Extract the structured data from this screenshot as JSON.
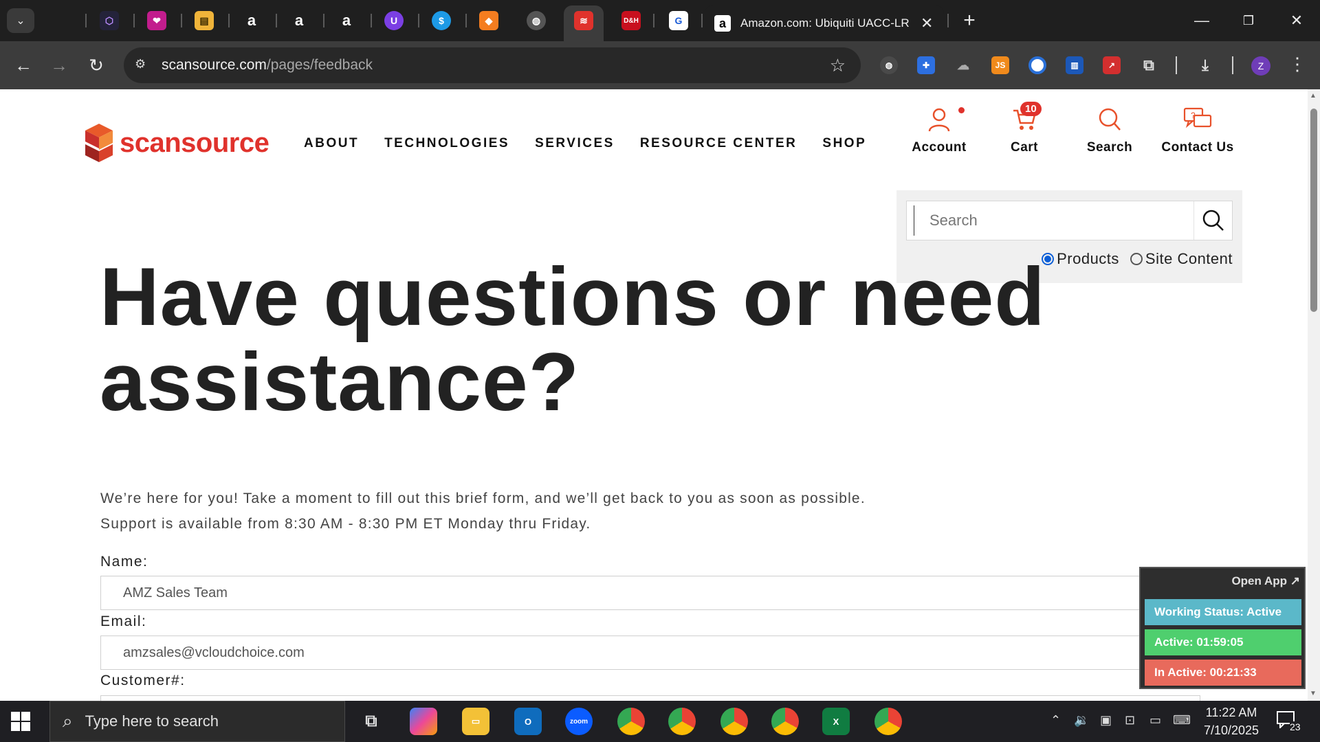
{
  "browser": {
    "active_tab_title": "Amazon.com: Ubiquiti UACC-LR",
    "tab_favicons": [
      "cube-icon",
      "heart-icon",
      "box-icon",
      "amazon-icon",
      "amazon-icon",
      "amazon-icon",
      "u-icon",
      "dollar-icon",
      "package-icon",
      "globe-icon",
      "scansource-icon",
      "dh-icon",
      "g-icon"
    ],
    "url_host": "scansource.com",
    "url_path": "/pages/feedback",
    "profile_initial": "Z",
    "ext_js_label": "JS"
  },
  "site": {
    "logo_text": "scansource",
    "nav": [
      "ABOUT",
      "TECHNOLOGIES",
      "SERVICES",
      "RESOURCE CENTER",
      "SHOP"
    ],
    "utility": {
      "account": "Account",
      "cart": "Cart",
      "cart_count": "10",
      "search": "Search",
      "contact": "Contact Us"
    },
    "search_panel": {
      "placeholder": "Search",
      "options": [
        "Products",
        "Site Content"
      ],
      "selected": "Products"
    },
    "heading": "Have questions or need assistance?",
    "intro_line1": "We’re here for you! Take a moment to fill out this brief form, and we’ll get back to you as soon as possible.",
    "intro_line2": "Support is available from 8:30 AM - 8:30 PM ET Monday thru Friday.",
    "form": {
      "name_label": "Name:",
      "name_value": "AMZ Sales Team",
      "email_label": "Email:",
      "email_value": "amzsales@vcloudchoice.com",
      "customer_label": "Customer#:"
    }
  },
  "tracker": {
    "open_app": "Open App ↗",
    "status": "Working Status: Active",
    "active": "Active: 01:59:05",
    "inactive": "In Active: 00:21:33",
    "colors": {
      "status": "#5bb8c9",
      "active": "#4fcf6e",
      "inactive": "#e86a5c"
    }
  },
  "taskbar": {
    "search_placeholder": "Type here to search",
    "time": "11:22 AM",
    "date": "7/10/2025",
    "notification_count": "23",
    "zoom_label": "zoom"
  }
}
